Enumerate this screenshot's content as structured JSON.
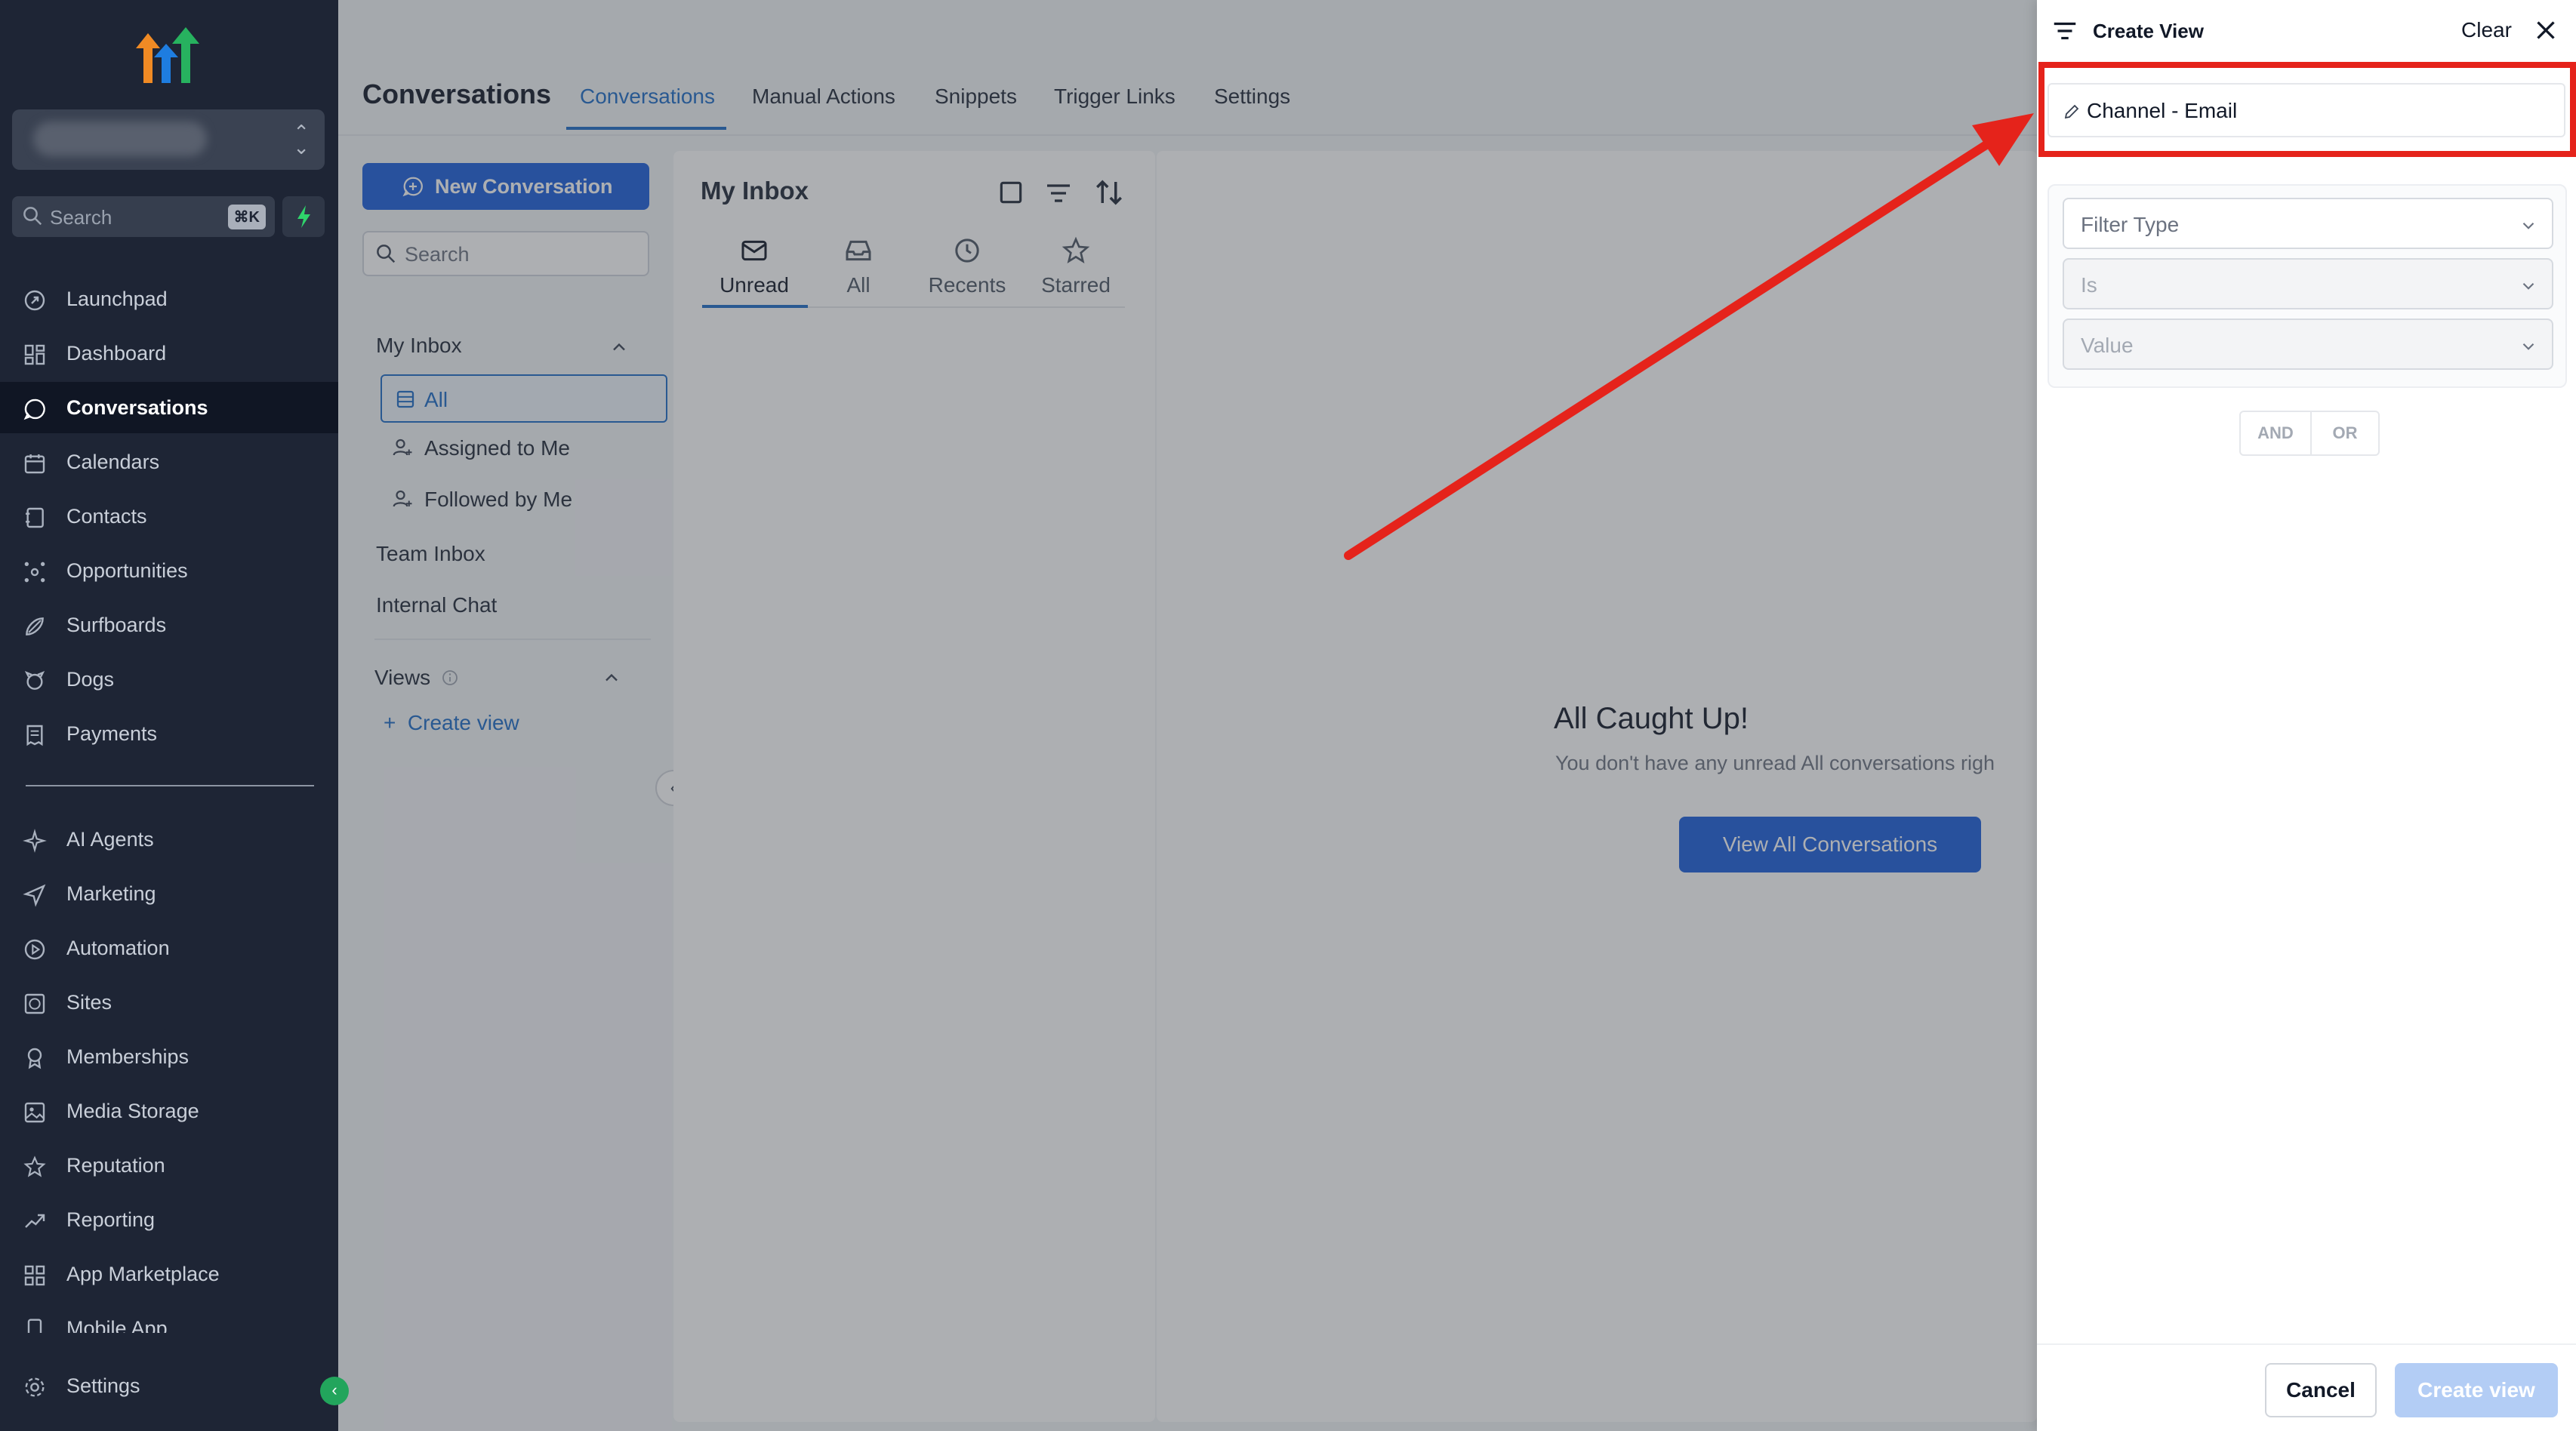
{
  "sidebar": {
    "search_label": "Search",
    "search_shortcut": "⌘K",
    "nav_top": [
      {
        "label": "Launchpad",
        "icon": "rocket-icon"
      },
      {
        "label": "Dashboard",
        "icon": "dashboard-icon"
      },
      {
        "label": "Conversations",
        "icon": "chat-icon",
        "active": true
      },
      {
        "label": "Calendars",
        "icon": "calendar-icon"
      },
      {
        "label": "Contacts",
        "icon": "contacts-icon"
      },
      {
        "label": "Opportunities",
        "icon": "network-icon"
      },
      {
        "label": "Surfboards",
        "icon": "surfboard-icon"
      },
      {
        "label": "Dogs",
        "icon": "paw-icon"
      },
      {
        "label": "Payments",
        "icon": "receipt-icon"
      }
    ],
    "nav_bottom": [
      {
        "label": "AI Agents",
        "icon": "sparkle-icon"
      },
      {
        "label": "Marketing",
        "icon": "send-icon"
      },
      {
        "label": "Automation",
        "icon": "play-circle-icon"
      },
      {
        "label": "Sites",
        "icon": "globe-box-icon"
      },
      {
        "label": "Memberships",
        "icon": "award-icon"
      },
      {
        "label": "Media Storage",
        "icon": "image-icon"
      },
      {
        "label": "Reputation",
        "icon": "star-icon"
      },
      {
        "label": "Reporting",
        "icon": "trend-icon"
      },
      {
        "label": "App Marketplace",
        "icon": "grid-icon"
      },
      {
        "label": "Mobile App",
        "icon": "phone-icon"
      }
    ],
    "settings_label": "Settings"
  },
  "header": {
    "title": "Conversations",
    "tabs": [
      "Conversations",
      "Manual Actions",
      "Snippets",
      "Trigger Links",
      "Settings"
    ]
  },
  "left_panel": {
    "new_conversation": "New Conversation",
    "search_placeholder": "Search",
    "my_inbox": "My Inbox",
    "inbox_items": [
      "All",
      "Assigned to Me",
      "Followed by Me"
    ],
    "team_inbox": "Team Inbox",
    "internal_chat": "Internal Chat",
    "views": "Views",
    "create_view": "Create view"
  },
  "inbox": {
    "title": "My Inbox",
    "tabs": [
      "Unread",
      "All",
      "Recents",
      "Starred"
    ]
  },
  "empty_state": {
    "title": "All Caught Up!",
    "subtitle": "You don't have any unread All conversations righ",
    "button": "View All Conversations"
  },
  "drawer": {
    "title": "Create View",
    "clear": "Clear",
    "view_name": "Channel - Email",
    "filter_type": "Filter Type",
    "operator": "Is",
    "value": "Value",
    "and": "AND",
    "or": "OR",
    "cancel": "Cancel",
    "create": "Create view"
  },
  "colors": {
    "sidebar_bg": "#1e2535",
    "accent": "#1a5edb",
    "annotation_red": "#e5231b"
  }
}
